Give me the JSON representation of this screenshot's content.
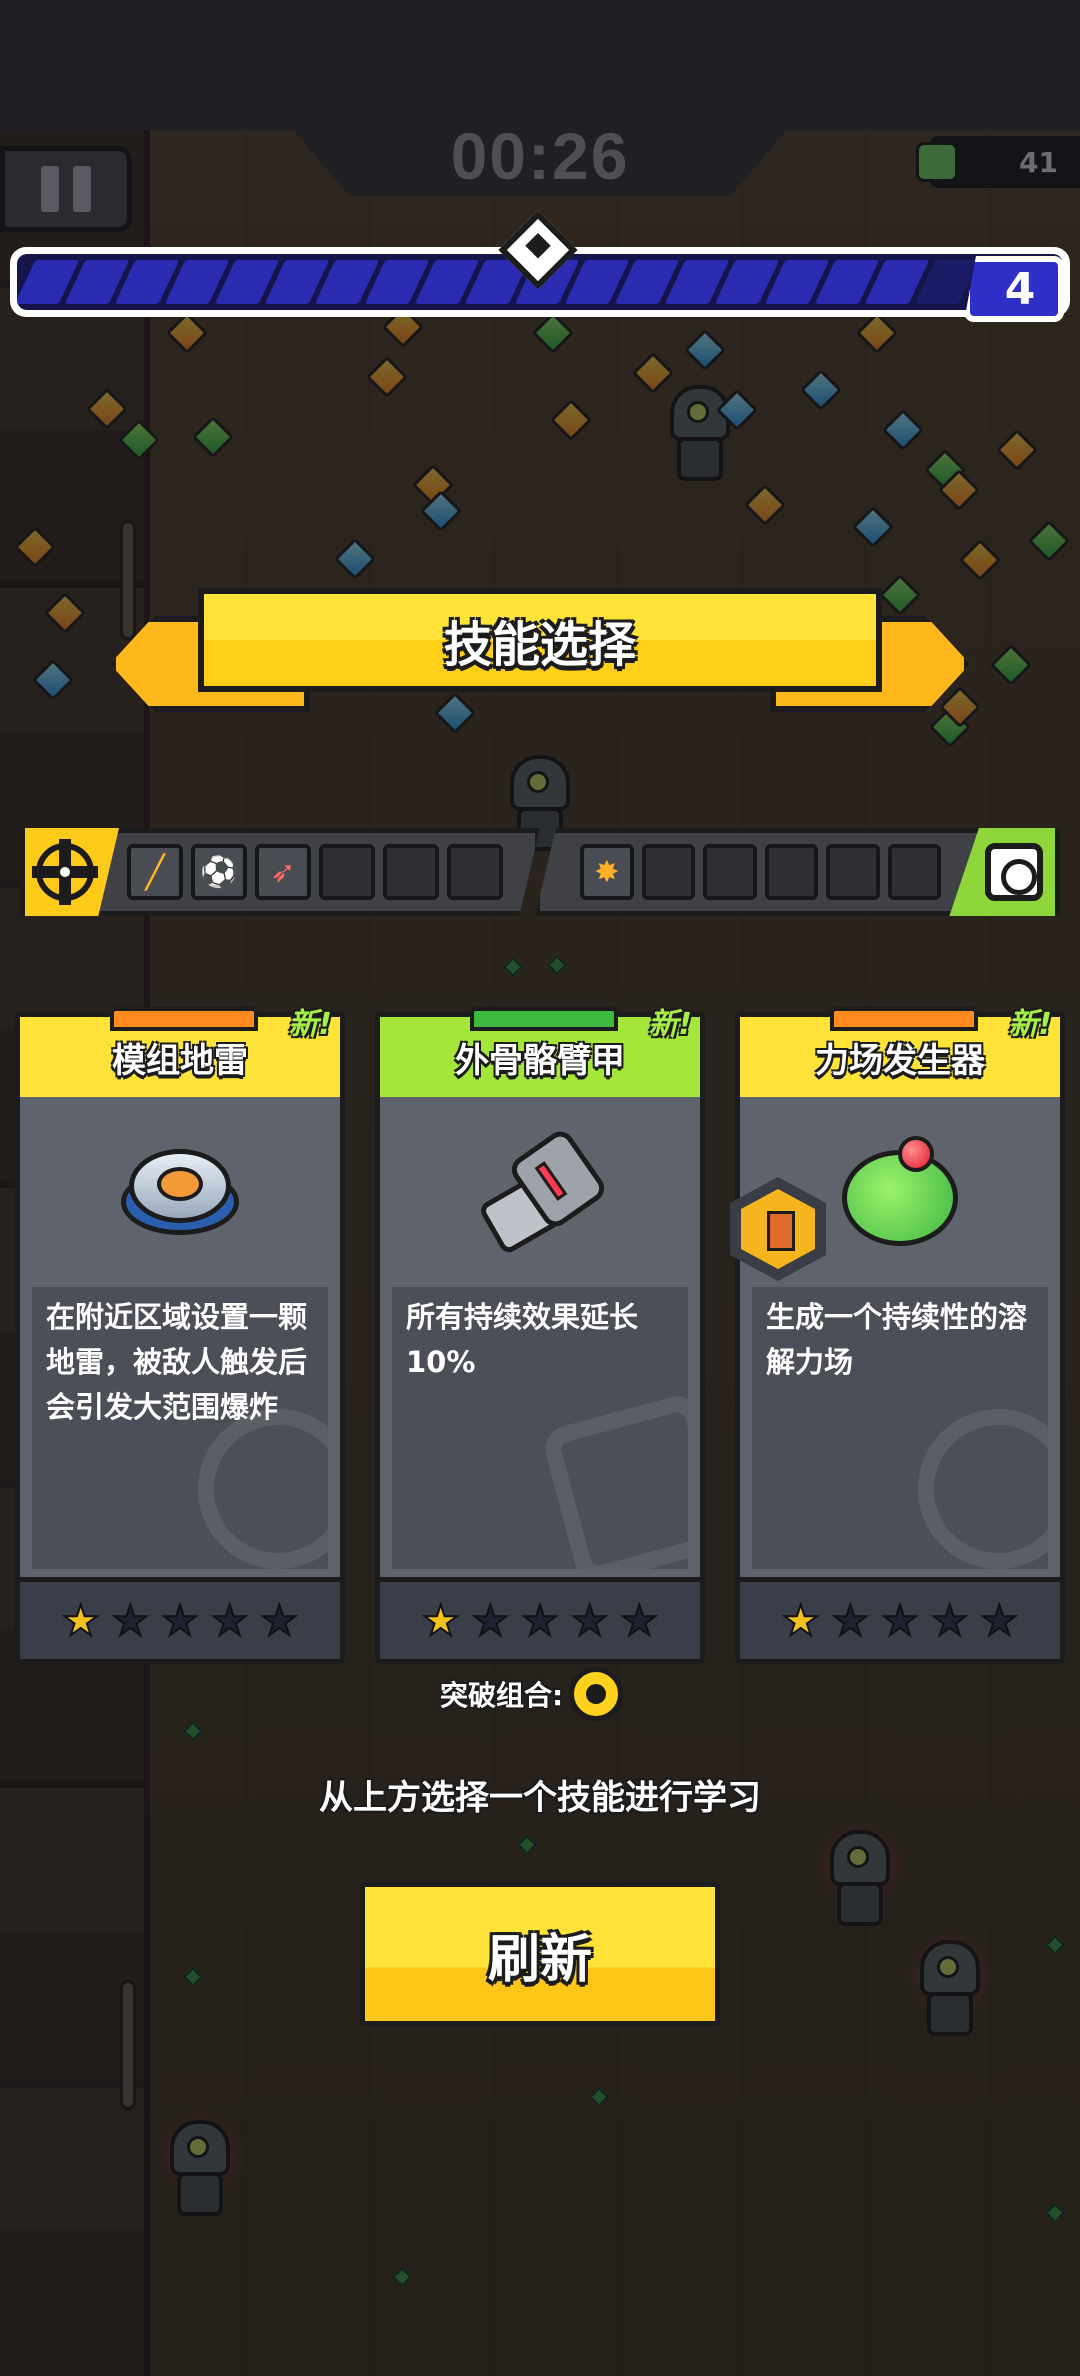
{
  "hud": {
    "timer": "00:26",
    "kills": "41",
    "level": "4",
    "xp_progress": 0.95
  },
  "title": "技能选择",
  "loadout": {
    "weapon_slots": [
      "knife-icon",
      "soccer-ball-icon",
      "rocket-icon",
      "",
      "",
      ""
    ],
    "passive_slots": [
      "bullet-badge-icon",
      "",
      "",
      "",
      "",
      ""
    ]
  },
  "cards": [
    {
      "name": "模组地雷",
      "new_badge": "新!",
      "description": "在附近区域设置一颗地雷，被敌人触发后会引发大范围爆炸",
      "stars": 1,
      "max_stars": 5,
      "icon": "landmine-icon",
      "color": "#ffe338"
    },
    {
      "name": "外骨骼臂甲",
      "new_badge": "新!",
      "description": "所有持续效果延长10%",
      "stars": 1,
      "max_stars": 5,
      "icon": "exo-arm-icon",
      "color": "#a5e63a"
    },
    {
      "name": "力场发生器",
      "new_badge": "新!",
      "description": "生成一个持续性的溶解力场",
      "stars": 1,
      "max_stars": 5,
      "icon": "force-field-icon",
      "color": "#ffe338"
    }
  ],
  "combo_label": "突破组合:",
  "hint": "从上方选择一个技能进行学习",
  "refresh_label": "刷新"
}
